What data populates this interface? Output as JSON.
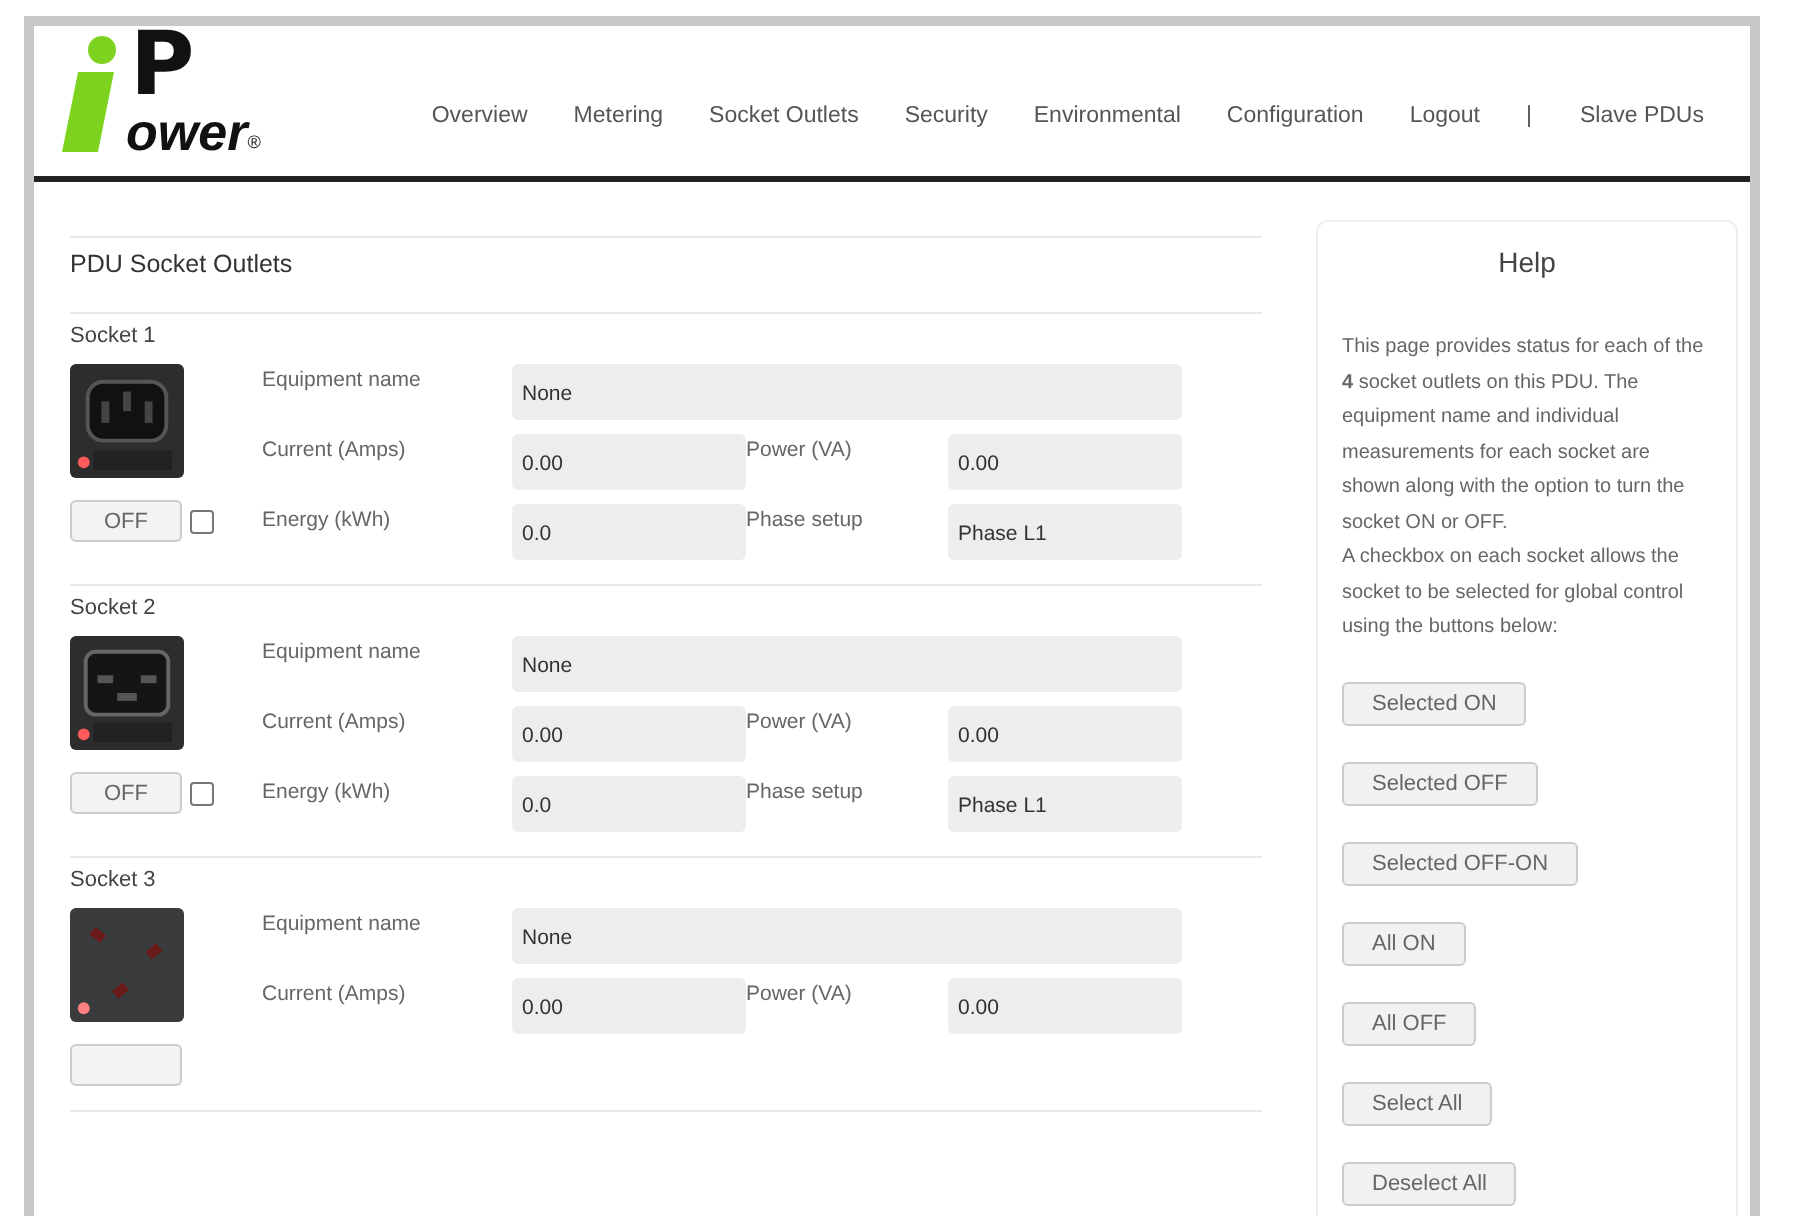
{
  "logo": {
    "letter": "P",
    "text": "ower",
    "mark": "®"
  },
  "nav": [
    {
      "label": "Overview",
      "kind": "link"
    },
    {
      "label": "Metering",
      "kind": "link"
    },
    {
      "label": "Socket Outlets",
      "kind": "link"
    },
    {
      "label": "Security",
      "kind": "link"
    },
    {
      "label": "Environmental",
      "kind": "link"
    },
    {
      "label": "Configuration",
      "kind": "link"
    },
    {
      "label": "Logout",
      "kind": "link"
    },
    {
      "label": "|",
      "kind": "separator"
    },
    {
      "label": "Slave PDUs",
      "kind": "link"
    }
  ],
  "page_title": "PDU Socket Outlets",
  "sockets": [
    {
      "title": "Socket 1",
      "kind": "c13",
      "switch_label": "OFF",
      "checked": false,
      "equipment_label": "Equipment name",
      "equipment_value": "None",
      "current_label": "Current (Amps)",
      "current_value": "0.00",
      "power_label": "Power (VA)",
      "power_value": "0.00",
      "energy_label": "Energy (kWh)",
      "energy_value": "0.0",
      "phase_label": "Phase setup",
      "phase_value": "Phase L1"
    },
    {
      "title": "Socket 2",
      "kind": "c19",
      "switch_label": "OFF",
      "checked": false,
      "equipment_label": "Equipment name",
      "equipment_value": "None",
      "current_label": "Current (Amps)",
      "current_value": "0.00",
      "power_label": "Power (VA)",
      "power_value": "0.00",
      "energy_label": "Energy (kWh)",
      "energy_value": "0.0",
      "phase_label": "Phase setup",
      "phase_value": "Phase L1"
    },
    {
      "title": "Socket 3",
      "kind": "uk",
      "equipment_label": "Equipment name",
      "equipment_value": "None",
      "current_label": "Current (Amps)",
      "current_value": "0.00",
      "power_label": "Power (VA)",
      "power_value": "0.00"
    }
  ],
  "help": {
    "title": "Help",
    "text": "This page provides status for each of the **4** socket outlets on this PDU. The equipment name and individual measurements for each socket are shown along with the option to turn the socket ON or OFF.",
    "text2": "A checkbox on each socket allows the socket to be selected for global control using the buttons below:",
    "buttons": [
      "Selected ON",
      "Selected OFF",
      "Selected OFF-ON",
      "All ON",
      "All OFF",
      "Select All",
      "Deselect All"
    ]
  }
}
